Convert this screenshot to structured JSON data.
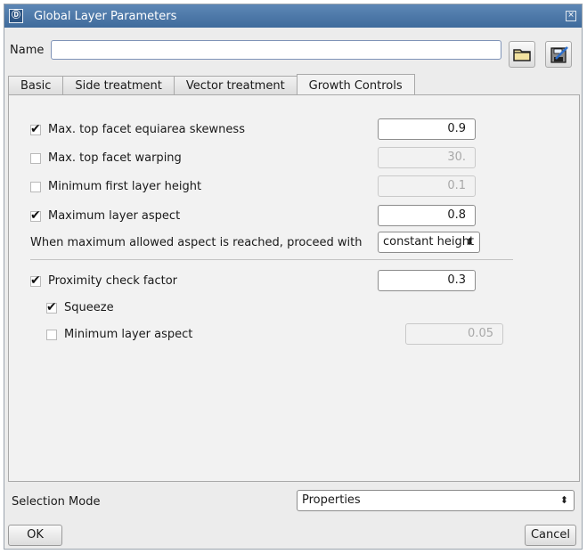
{
  "window": {
    "title": "Global Layer Parameters"
  },
  "name_row": {
    "label": "Name",
    "value": "",
    "placeholder": ""
  },
  "tabs": [
    {
      "label": "Basic",
      "active": false
    },
    {
      "label": "Side treatment",
      "active": false
    },
    {
      "label": "Vector treatment",
      "active": false
    },
    {
      "label": "Growth Controls",
      "active": true
    }
  ],
  "growth": {
    "skewness": {
      "label": "Max. top facet equiarea skewness",
      "checked": true,
      "value": "0.9"
    },
    "warping": {
      "label": "Max. top facet warping",
      "checked": false,
      "value": "30."
    },
    "first_height": {
      "label": "Minimum first layer height",
      "checked": false,
      "value": "0.1"
    },
    "max_aspect": {
      "label": "Maximum layer aspect",
      "checked": true,
      "value": "0.8"
    },
    "proceed": {
      "label": "When maximum allowed aspect is reached, proceed with",
      "value": "constant height"
    },
    "proximity": {
      "label": "Proximity check factor",
      "checked": true,
      "value": "0.3"
    },
    "squeeze": {
      "label": "Squeeze",
      "checked": true
    },
    "min_aspect": {
      "label": "Minimum layer aspect",
      "checked": false,
      "value": "0.05"
    }
  },
  "footer": {
    "selection_mode_label": "Selection Mode",
    "selection_mode_value": "Properties",
    "ok": "OK",
    "cancel": "Cancel"
  },
  "icons": {
    "check": "✔",
    "spinner": "⬍",
    "app": "app-icon",
    "open": "folder-open-icon",
    "save": "save-icon"
  }
}
